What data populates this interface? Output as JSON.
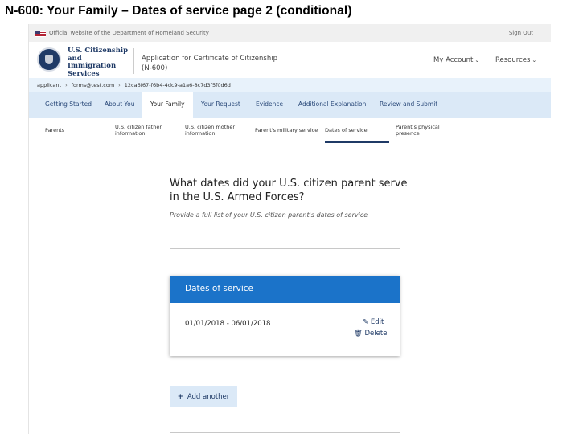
{
  "slide": {
    "title": "N-600: Your Family – Dates of service page 2 (conditional)"
  },
  "banner": {
    "text": "Official website of the Department of Homeland Security",
    "sign_out": "Sign Out"
  },
  "header": {
    "agency": [
      "U.S. Citizenship",
      "and Immigration",
      "Services"
    ],
    "app_title_line1": "Application for Certificate of Citizenship",
    "app_title_line2": "(N-600)",
    "menu": [
      {
        "label": "My Account"
      },
      {
        "label": "Resources"
      }
    ]
  },
  "breadcrumb": {
    "items": [
      "applicant",
      "forms@test.com",
      "12ca6f67-f6b4-4dc9-a1a6-8c7d3f5f0d6d"
    ]
  },
  "nav": {
    "tabs": [
      {
        "label": "Getting Started"
      },
      {
        "label": "About You"
      },
      {
        "label": "Your Family",
        "active": true
      },
      {
        "label": "Your Request"
      },
      {
        "label": "Evidence"
      },
      {
        "label": "Additional Explanation"
      },
      {
        "label": "Review and Submit"
      }
    ]
  },
  "subnav": {
    "items": [
      {
        "label": "Parents"
      },
      {
        "label": "U.S. citizen father information"
      },
      {
        "label": "U.S. citizen mother information"
      },
      {
        "label": "Parent's military service"
      },
      {
        "label": "Dates of service",
        "active": true
      },
      {
        "label": "Parent's physical presence"
      }
    ]
  },
  "main": {
    "question": "What dates did your U.S. citizen parent serve in the U.S. Armed Forces?",
    "hint": "Provide a full list of your U.S. citizen parent's dates of service",
    "card": {
      "title": "Dates of service",
      "date_range": "01/01/2018 - 06/01/2018",
      "edit_label": "Edit",
      "delete_label": "Delete"
    },
    "add_button": "Add another"
  },
  "colors": {
    "accent": "#1b73c9",
    "nav_bg": "#dbe9f7",
    "crumb_bg": "#e8f2fb",
    "brand": "#1f3a66"
  }
}
